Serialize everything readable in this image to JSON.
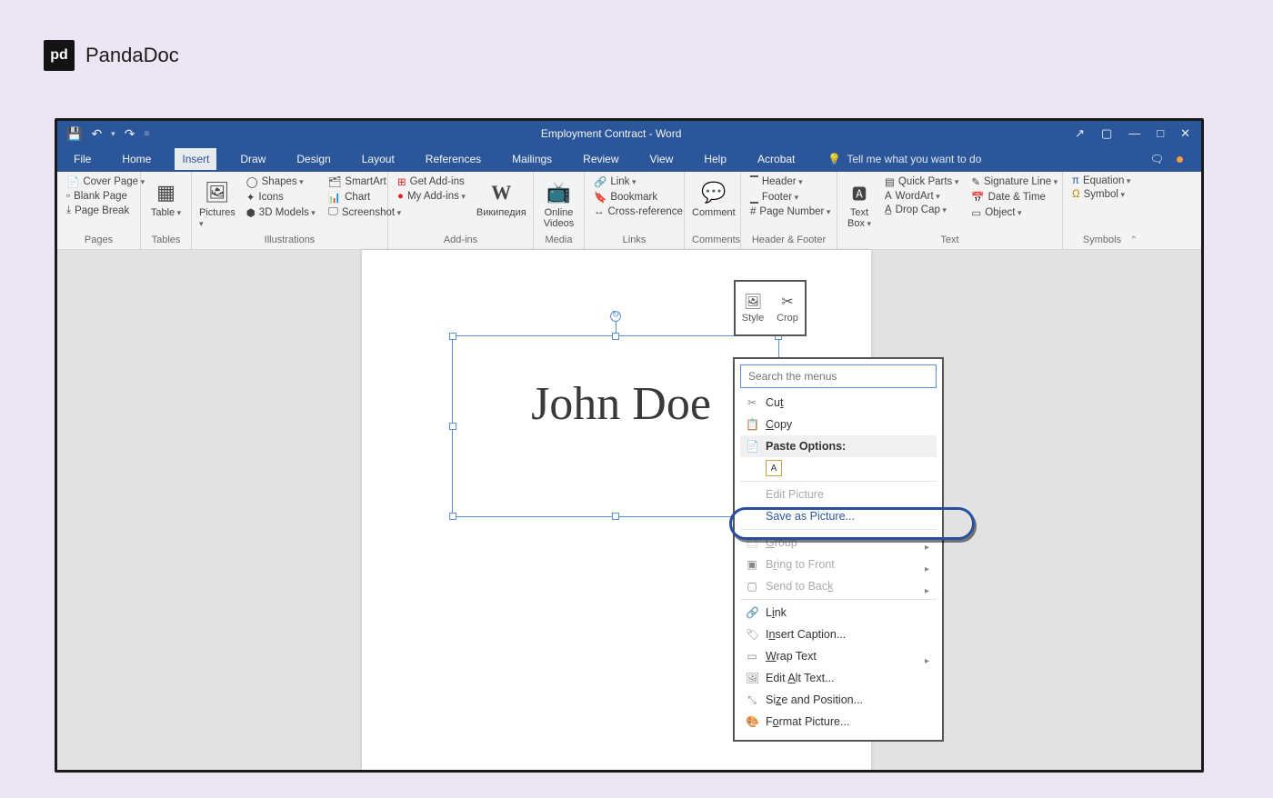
{
  "brand": {
    "icon_label": "pd",
    "name": "PandaDoc"
  },
  "titlebar": {
    "qat": {
      "save": "💾",
      "undo": "↶",
      "redo": "↷",
      "refresh": "⟳"
    },
    "title": "Employment Contract - Word",
    "win": {
      "share": "↗",
      "ribbon": "▢",
      "min": "—",
      "max": "□",
      "close": "✕"
    }
  },
  "menubar": {
    "tabs": [
      "File",
      "Home",
      "Insert",
      "Draw",
      "Design",
      "Layout",
      "References",
      "Mailings",
      "Review",
      "View",
      "Help",
      "Acrobat"
    ],
    "active_index": 2,
    "tell_me": "Tell me what you want to do",
    "bulb": "💡",
    "comment_icon": "🗨"
  },
  "ribbon": {
    "pages": {
      "label": "Pages",
      "items": [
        "Cover Page",
        "Blank Page",
        "Page Break"
      ]
    },
    "tables": {
      "label": "Tables",
      "button": "Table"
    },
    "illustrations": {
      "label": "Illustrations",
      "pictures": "Pictures",
      "items": [
        "Shapes",
        "Icons",
        "3D Models",
        "SmartArt",
        "Chart",
        "Screenshot"
      ]
    },
    "addins": {
      "label": "Add-ins",
      "get": "Get Add-ins",
      "my": "My Add-ins",
      "wiki_glyph": "W",
      "wiki_label": "Википедия"
    },
    "media": {
      "label": "Media",
      "online": "Online\nVideos"
    },
    "links": {
      "label": "Links",
      "items": [
        "Link",
        "Bookmark",
        "Cross-reference"
      ]
    },
    "comments": {
      "label": "Comments",
      "button": "Comment"
    },
    "header_footer": {
      "label": "Header & Footer",
      "items": [
        "Header",
        "Footer",
        "Page Number"
      ]
    },
    "text": {
      "label": "Text",
      "textbox": "Text\nBox",
      "col1": [
        "Quick Parts",
        "WordArt",
        "Drop Cap"
      ],
      "col2": [
        "Signature Line",
        "Date & Time",
        "Object"
      ]
    },
    "symbols": {
      "label": "Symbols",
      "items": [
        "Equation",
        "Symbol"
      ]
    }
  },
  "document": {
    "signature": "John Doe"
  },
  "mini_toolbar": {
    "style": "Style",
    "crop": "Crop"
  },
  "context_menu": {
    "search_placeholder": "Search the menus",
    "cut": "Cut",
    "copy": "Copy",
    "paste_header": "Paste Options:",
    "edit_picture": "Edit Picture",
    "save_as_picture": "Save as Picture...",
    "group": "Group",
    "bring_front": "Bring to Front",
    "send_back": "Send to Back",
    "link": "Link",
    "insert_caption": "Insert Caption...",
    "wrap_text": "Wrap Text",
    "edit_alt": "Edit Alt Text...",
    "size_pos": "Size and Position...",
    "format_picture": "Format Picture..."
  }
}
